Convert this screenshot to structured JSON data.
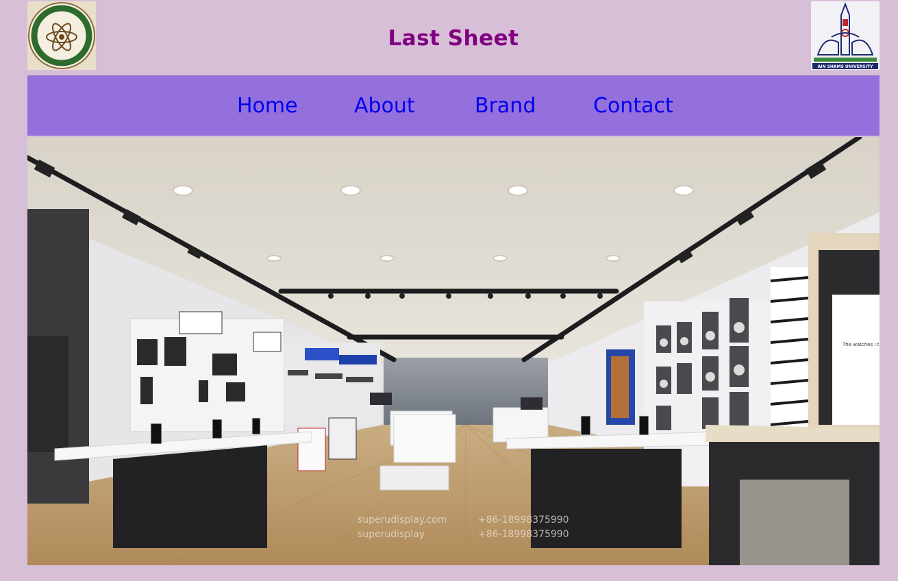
{
  "header": {
    "title": "Last Sheet",
    "logo_left_name": "faculty-of-science-logo",
    "logo_left_text": "FACULTY OF SCIENCE",
    "logo_right_name": "ain-shams-university-logo",
    "logo_right_text": "AIN SHAMS UNIVERSITY"
  },
  "nav": {
    "items": [
      {
        "label": "Home"
      },
      {
        "label": "About"
      },
      {
        "label": "Brand"
      },
      {
        "label": "Contact"
      }
    ]
  },
  "hero": {
    "watermark_site": "superudisplay.com",
    "watermark_phone": "+86-18998375990",
    "watermark_social": "superudisplay",
    "watermark_phone2": "+86-18998375990",
    "sign_text": "The watches i that minimalis"
  },
  "colors": {
    "page_background": "#d8bfd8",
    "nav_background": "#9370db",
    "title_color": "#800080",
    "link_color": "#0000ee"
  }
}
